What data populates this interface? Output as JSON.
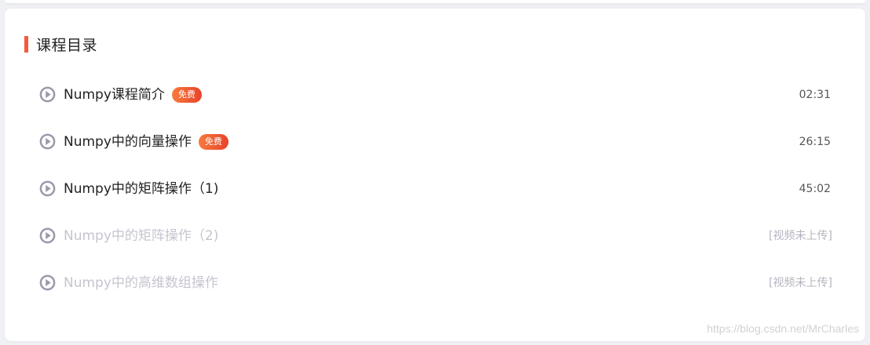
{
  "section": {
    "title": "课程目录"
  },
  "lessons": [
    {
      "title": "Numpy课程简介",
      "badge": "免费",
      "duration": "02:31",
      "available": true
    },
    {
      "title": "Numpy中的向量操作",
      "badge": "免费",
      "duration": "26:15",
      "available": true
    },
    {
      "title": "Numpy中的矩阵操作（1)",
      "badge": "",
      "duration": "45:02",
      "available": true
    },
    {
      "title": "Numpy中的矩阵操作（2)",
      "badge": "",
      "duration": "[视频未上传]",
      "available": false
    },
    {
      "title": "Numpy中的高维数组操作",
      "badge": "",
      "duration": "[视频未上传]",
      "available": false
    }
  ],
  "watermark": "https://blog.csdn.net/MrCharles",
  "colors": {
    "accent": "#f4593b",
    "play_icon": "#9a9aab",
    "badge_start": "#f77a3c",
    "badge_end": "#e8432a",
    "disabled_text": "#c5c5d0"
  },
  "icons": {
    "lesson": "play-circle-icon"
  }
}
